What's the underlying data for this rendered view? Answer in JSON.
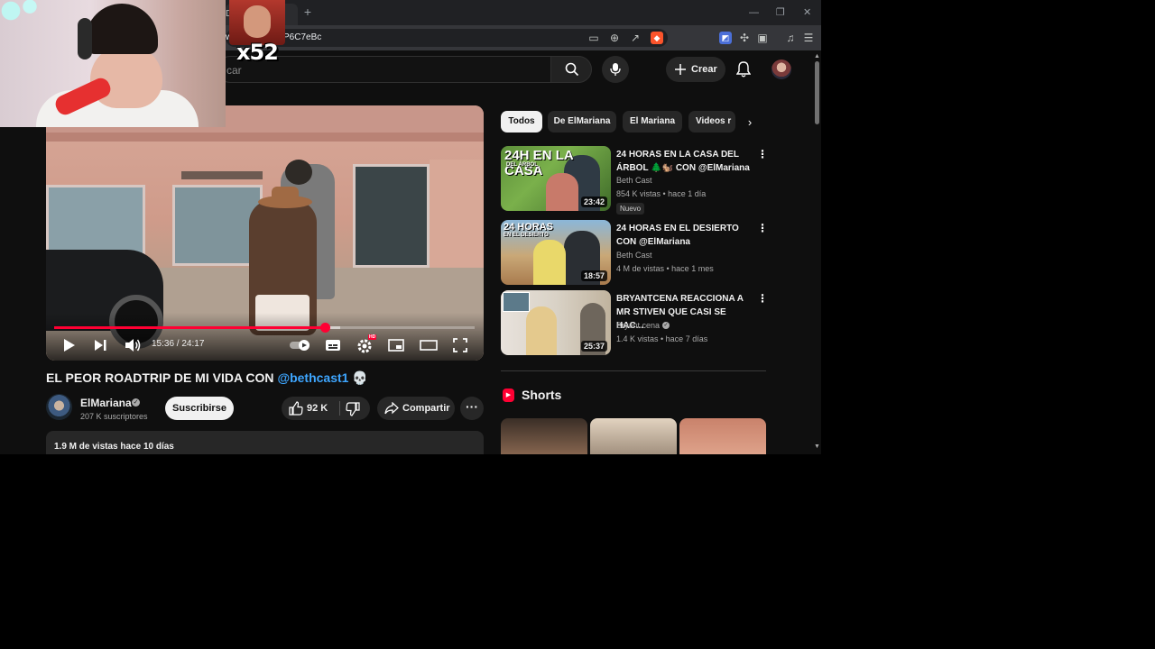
{
  "browser": {
    "url_visible": "P6C7eBc",
    "tab_partial_text": "De",
    "address_partial_text": "wa"
  },
  "yt_header": {
    "search_placeholder_partial": "car",
    "create_label": "Crear"
  },
  "video": {
    "time_display": "15:36 / 24:17",
    "progress_fraction": 0.643,
    "buffered_fraction": 0.68,
    "title_prefix": "EL PEOR ROADTRIP DE MI VIDA CON ",
    "title_mention": "@bethcast1",
    "title_emoji": "💀",
    "settings_badge": "HD"
  },
  "channel": {
    "name": "ElMariana",
    "subscribers": "207 K suscriptores",
    "subscribe_label": "Suscribirse"
  },
  "actions": {
    "like_count": "92 K",
    "share_label": "Compartir"
  },
  "description": {
    "meta": "1.9 M de vistas  hace 10 días"
  },
  "chips": [
    {
      "label": "Todos"
    },
    {
      "label": "De ElMariana"
    },
    {
      "label": "El Mariana"
    },
    {
      "label": "Videos r"
    }
  ],
  "recommendations": [
    {
      "title": "24 HORAS EN LA CASA DEL ÁRBOL 🌲🐿️ CON @ElMariana",
      "channel": "Beth Cast",
      "meta": "854 K vistas • hace 1 día",
      "badge": "Nuevo",
      "duration": "23:42",
      "thumb_text": "24H EN LA CASA",
      "thumb_subtext": "DEL ÁRBOL"
    },
    {
      "title": "24 HORAS EN EL DESIERTO CON @ElMariana",
      "channel": "Beth Cast",
      "meta": "4 M de vistas • hace 1 mes",
      "duration": "18:57",
      "thumb_text": "24 HORAS",
      "thumb_subtext": "EN EL DESIERTO"
    },
    {
      "title": "BRYANTCENA REACCIONA A MR STIVEN QUE CASI SE HAC...",
      "channel": "Bryant cena",
      "meta": "1.4 K vistas • hace 7 días",
      "duration": "25:37"
    }
  ],
  "shorts": {
    "title": "Shorts"
  },
  "overlay": {
    "emote_count": "x52"
  },
  "colors": {
    "accent": "#ff0033",
    "mention": "#3ea6ff",
    "background": "#0f0f0f",
    "chip_bg": "#272727"
  }
}
